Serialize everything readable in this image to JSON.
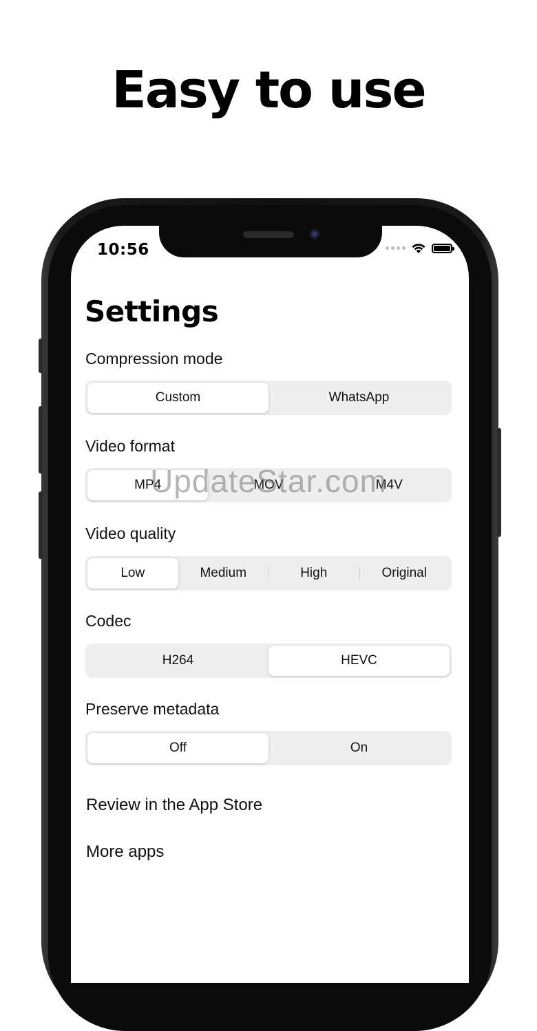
{
  "headline": "Easy to use",
  "status_bar": {
    "time": "10:56"
  },
  "settings": {
    "title": "Settings",
    "compression_mode": {
      "label": "Compression mode",
      "options": [
        "Custom",
        "WhatsApp"
      ],
      "selected": "Custom"
    },
    "video_format": {
      "label": "Video format",
      "options": [
        "MP4",
        "MOV",
        "M4V"
      ],
      "selected": "MP4"
    },
    "video_quality": {
      "label": "Video quality",
      "options": [
        "Low",
        "Medium",
        "High",
        "Original"
      ],
      "selected": "Low"
    },
    "codec": {
      "label": "Codec",
      "options": [
        "H264",
        "HEVC"
      ],
      "selected": "HEVC"
    },
    "preserve_metadata": {
      "label": "Preserve metadata",
      "options": [
        "Off",
        "On"
      ],
      "selected": "Off"
    },
    "links": {
      "review": "Review in the App Store",
      "more_apps": "More apps"
    }
  },
  "watermark": "UpdateStar.com",
  "icons": [
    "wifi-icon",
    "battery-icon",
    "cellular-signal-icon",
    "front-camera-icon"
  ]
}
